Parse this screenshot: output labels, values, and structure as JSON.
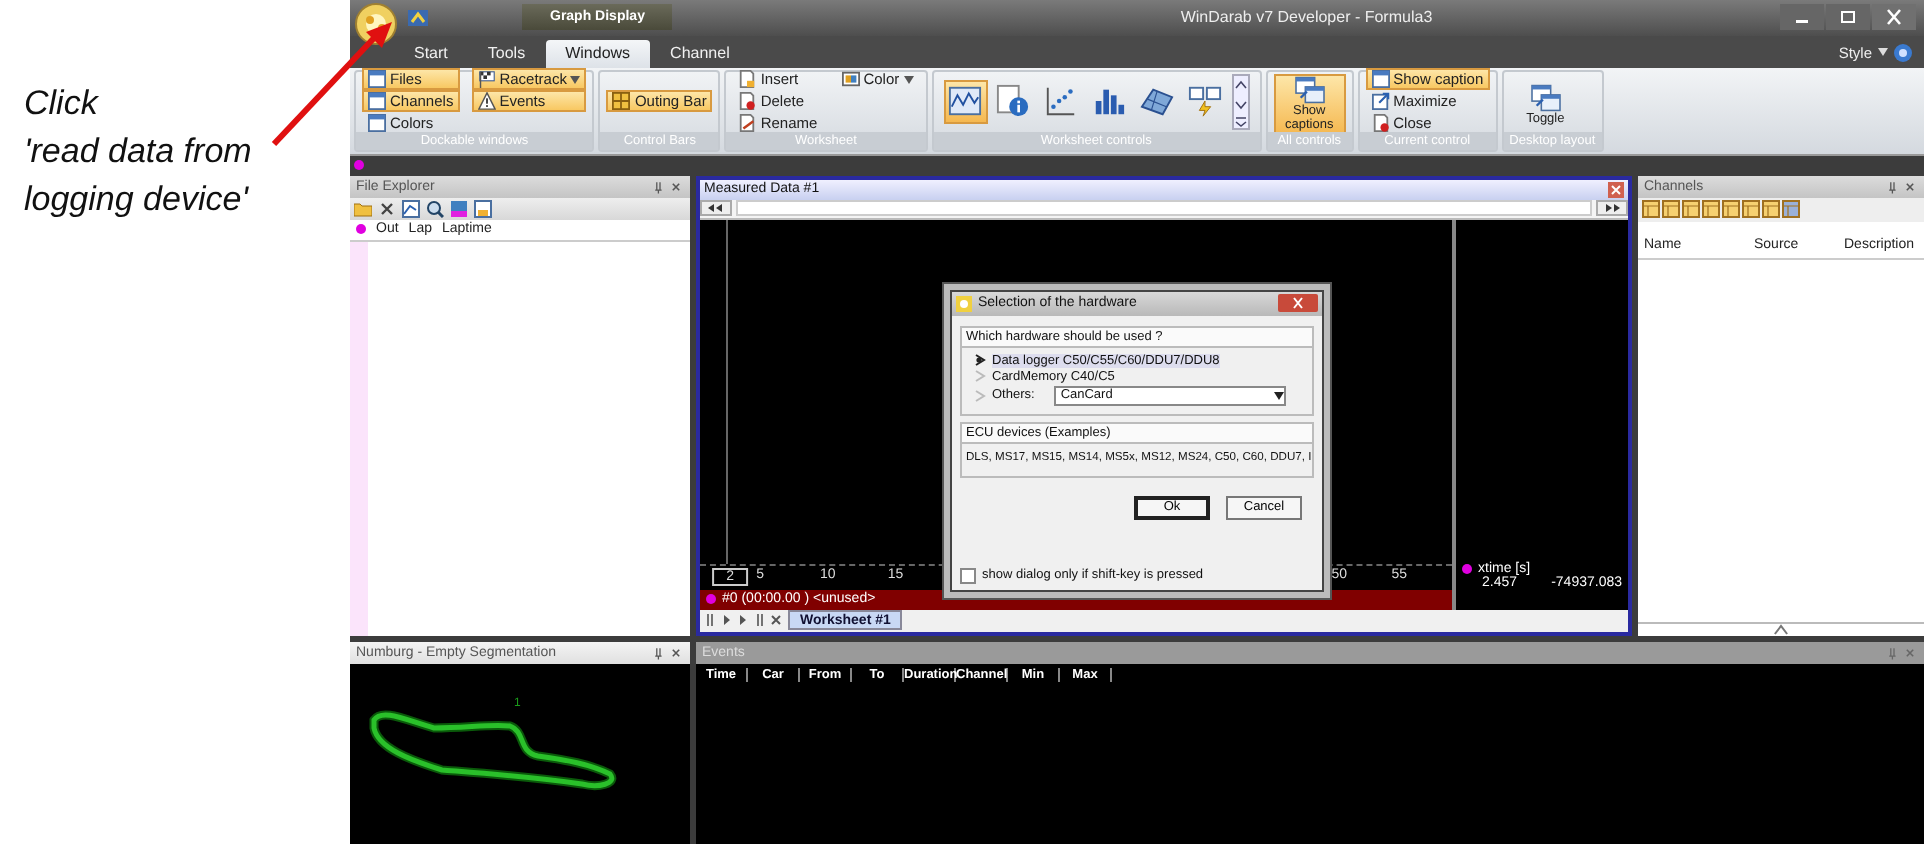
{
  "annotation": {
    "lines": [
      "Click",
      "'read data from logging device'"
    ]
  },
  "window": {
    "title": "WinDarab v7 Developer - Formula3",
    "context_label": "Graph Display"
  },
  "ribbon_tabs": [
    {
      "label": "Start",
      "selected": false
    },
    {
      "label": "Tools",
      "selected": false
    },
    {
      "label": "Windows",
      "selected": true
    },
    {
      "label": "Channel",
      "selected": false
    }
  ],
  "style_menu": "Style",
  "ribbon_groups": [
    {
      "title": "Dockable windows",
      "kind": "small",
      "buttons": [
        {
          "label": "Files",
          "kind": "window",
          "on": true,
          "has_menu": false
        },
        {
          "label": "Channels",
          "kind": "window",
          "on": true,
          "has_menu": false
        },
        {
          "label": "Colors",
          "kind": "window",
          "on": false,
          "has_menu": false
        },
        {
          "label": "Racetrack",
          "kind": "flag",
          "on": true,
          "has_menu": true
        },
        {
          "label": "Events",
          "kind": "warning",
          "on": true,
          "has_menu": false
        }
      ]
    },
    {
      "title": "Control Bars",
      "kind": "small",
      "buttons": [
        {
          "label": "Outing Bar",
          "kind": "grid",
          "on": true,
          "has_menu": false
        }
      ]
    },
    {
      "title": "Worksheet",
      "kind": "small",
      "buttons": [
        {
          "label": "Insert",
          "kind": "page",
          "on": false,
          "has_menu": false
        },
        {
          "label": "Delete",
          "kind": "delete",
          "on": false,
          "has_menu": false
        },
        {
          "label": "Rename",
          "kind": "rename",
          "on": false,
          "has_menu": false
        },
        {
          "label": "Color",
          "kind": "palette",
          "on": false,
          "has_menu": true
        }
      ]
    },
    {
      "title": "Worksheet controls",
      "kind": "gallery",
      "items": [
        {
          "kind": "line",
          "selected": true
        },
        {
          "kind": "info",
          "selected": false
        },
        {
          "kind": "scatter",
          "selected": false
        },
        {
          "kind": "bars",
          "selected": false
        },
        {
          "kind": "surface",
          "selected": false
        },
        {
          "kind": "layout",
          "selected": false
        }
      ]
    },
    {
      "title": "All controls",
      "kind": "large",
      "buttons": [
        {
          "label": "Show captions",
          "kind": "windows",
          "on": true
        }
      ]
    },
    {
      "title": "Current control",
      "kind": "small",
      "buttons": [
        {
          "label": "Show caption",
          "kind": "window",
          "on": true,
          "has_menu": false
        },
        {
          "label": "Maximize",
          "kind": "maximize",
          "on": false,
          "has_menu": false
        },
        {
          "label": "Close",
          "kind": "delete",
          "on": false,
          "has_menu": false
        }
      ]
    },
    {
      "title": "Desktop layout",
      "kind": "large",
      "buttons": [
        {
          "label": "Toggle",
          "kind": "windows",
          "on": false
        }
      ]
    }
  ],
  "file_explorer": {
    "title": "File Explorer",
    "columns": [
      "Out",
      "Lap",
      "Laptime"
    ]
  },
  "measured_data": {
    "title": "Measured Data #1",
    "axis_ticks": [
      {
        "label": "2",
        "boxed": true
      },
      {
        "label": "5",
        "boxed": false
      },
      {
        "label": "10",
        "boxed": false
      },
      {
        "label": "15",
        "boxed": false
      },
      {
        "label": "50",
        "boxed": false
      },
      {
        "label": "55",
        "boxed": false
      }
    ],
    "status": "#0 (00:00.00 ) <unused>",
    "legend": {
      "channel": "xtime [s]",
      "value": "2.457",
      "value_2": "-74937.083"
    },
    "sheet_tabs": [
      {
        "label": "Worksheet #1",
        "selected": true
      }
    ]
  },
  "dialog": {
    "title": "Selection of the hardware",
    "question": "Which hardware should be used ?",
    "options": [
      {
        "label": "Data logger C50/C55/C60/DDU7/DDU8",
        "selected": true
      },
      {
        "label": "CardMemory C40/C5",
        "selected": false
      },
      {
        "label": "Others:",
        "selected": false
      }
    ],
    "others_value": "CanCard",
    "ecu_heading": "ECU devices (Examples)",
    "ecu_list": "DLS, MS17, MS15, MS14, MS5x, MS12, MS24, C50, C60, DDU7, I",
    "buttons": [
      {
        "label": "Ok",
        "default": true
      },
      {
        "label": "Cancel",
        "default": false
      }
    ],
    "shift_option": {
      "label": "show dialog only if shift-key is pressed",
      "checked": false
    }
  },
  "channels": {
    "title": "Channels",
    "columns": [
      "Name",
      "Source",
      "Description"
    ]
  },
  "track_panel": {
    "title": "Numburg - Empty Segmentation",
    "segment_label": "1"
  },
  "events": {
    "title": "Events",
    "columns": [
      "Time",
      "Car",
      "From",
      "To",
      "Duration",
      "Channel",
      "Min",
      "Max"
    ]
  }
}
